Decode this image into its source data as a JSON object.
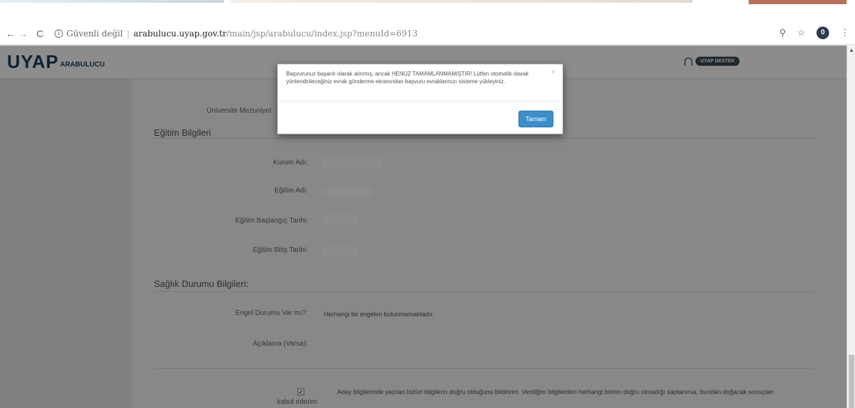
{
  "browser": {
    "security_label": "Güvenli değil",
    "info_glyph": "i",
    "separator": "|",
    "url_host": "arabulucu.uyap.gov.tr",
    "url_path": "/main/jsp/arabulucu/index.jsp?menuId=6913",
    "back_glyph": "←",
    "forward_glyph": "→",
    "reload_glyph": "C",
    "zoom_glyph": "⚲",
    "star_glyph": "☆",
    "extension_badge": "0",
    "menu_glyph": "⋮"
  },
  "app": {
    "logo_main": "UYAP",
    "logo_sub": "ARABULUCU",
    "support_button": "UYAP DESTEK"
  },
  "form": {
    "graduation_label": "Üniversite Mezuniyet",
    "education_section": "Eğitim Bilgileri",
    "institution_label": "Kurum Adı:",
    "education_name_label": "Eğitim Adı:",
    "start_date_label": "Eğitim Başlangıç Tarihi:",
    "end_date_label": "Eğitim Bitiş Tarihi:",
    "health_section": "Sağlık Durumu Bilgileri:",
    "disability_label": "Engel Durumu Var mı?:",
    "disability_value": "Herhangi bir engelim bulunmamaktadır.",
    "explanation_label": "Açıklama (Varsa):",
    "consent_checkbox_glyph": "✔",
    "consent_label": "kabul ederim",
    "consent_text": "Aday bilgilerinde yazılan bütün bilgilerin doğru olduğunu bildiririm. Verdiğim bilgilerden herhangi birinin doğru olmadığı saptanırsa, bundan doğacak sonuçları"
  },
  "modal": {
    "message": "Başvurunuz başarılı olarak alınmış, ancak HENÜZ TAMAMLANMAMIŞTIR! Lütfen otomatik olarak yönlendirileceğiniz evrak gönderme ekranından başvuru evraklarınızı sisteme yükleyiniz.",
    "close_glyph": "×",
    "ok_button": "Tamam"
  },
  "colors": {
    "brand": "#1d3c5a",
    "ok_button": "#3d8ec8"
  }
}
